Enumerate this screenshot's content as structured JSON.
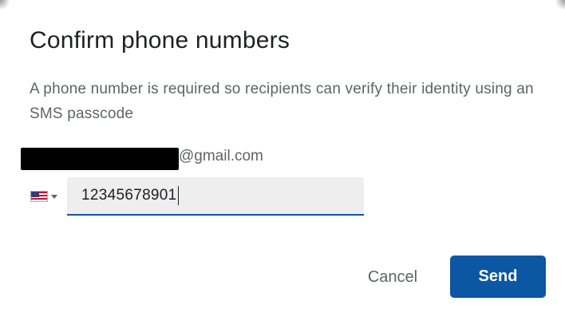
{
  "dialog": {
    "title": "Confirm phone numbers",
    "description": "A phone number is required so recipients can verify their identity using an SMS passcode"
  },
  "recipient": {
    "email_suffix": "@gmail.com"
  },
  "phone": {
    "country_flag": "us-flag-icon",
    "value": "12345678901"
  },
  "actions": {
    "cancel_label": "Cancel",
    "send_label": "Send"
  },
  "colors": {
    "primary": "#0b57a4",
    "title_text": "#202124",
    "secondary_text": "#5f6368",
    "field_background": "#eeeeee"
  }
}
